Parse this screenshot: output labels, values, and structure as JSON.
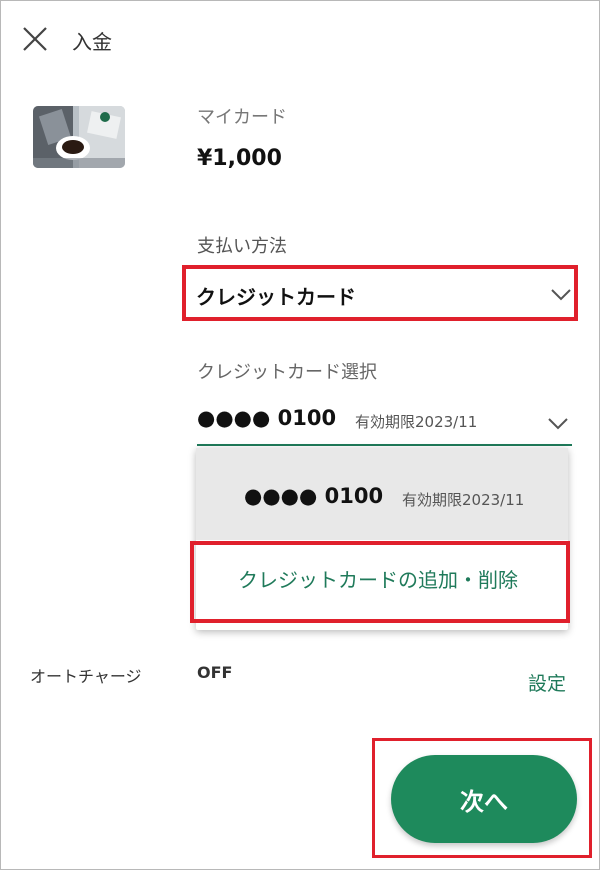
{
  "header": {
    "title": "入金",
    "close_icon": "close-icon"
  },
  "card": {
    "label": "マイカード",
    "amount": "¥1,000",
    "image_icon": "card-image"
  },
  "payment": {
    "label": "支払い方法",
    "selected": "クレジットカード",
    "chevron_icon": "chevron-down-icon"
  },
  "credit_card": {
    "label": "クレジットカード選択",
    "selected_number": "●●●● 0100",
    "selected_expiry": "有効期限2023/11",
    "chevron_icon": "chevron-down-icon"
  },
  "dropdown": {
    "options": [
      {
        "number": "●●●● 0100",
        "expiry": "有効期限2023/11"
      }
    ],
    "add_remove_label": "クレジットカードの追加・削除"
  },
  "auto_charge": {
    "label": "オートチャージ",
    "value": "OFF",
    "settings_link": "設定"
  },
  "footer": {
    "next_button": "次へ"
  },
  "colors": {
    "accent": "#1e8a5c",
    "link": "#1f7a5a",
    "highlight": "#e0202c",
    "selected_bg": "#e8e8e8"
  }
}
